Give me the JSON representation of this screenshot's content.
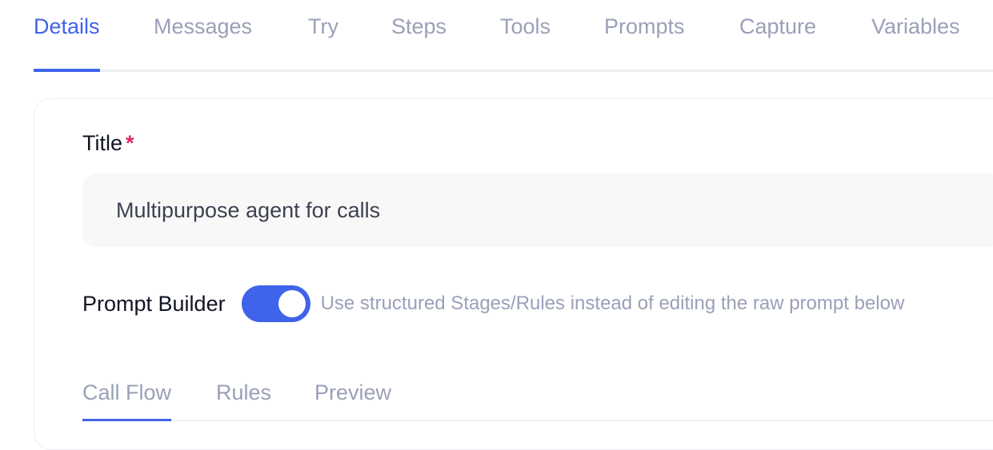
{
  "tabs": [
    {
      "label": "Details",
      "active": true
    },
    {
      "label": "Messages",
      "active": false
    },
    {
      "label": "Try",
      "active": false
    },
    {
      "label": "Steps",
      "active": false
    },
    {
      "label": "Tools",
      "active": false
    },
    {
      "label": "Prompts",
      "active": false
    },
    {
      "label": "Capture",
      "active": false
    },
    {
      "label": "Variables",
      "active": false
    }
  ],
  "form": {
    "title_label": "Title",
    "required_mark": "*",
    "title_value": "Multipurpose agent for calls",
    "prompt_builder_label": "Prompt Builder",
    "prompt_builder_enabled": true,
    "prompt_builder_hint": "Use structured Stages/Rules instead of editing the raw prompt below"
  },
  "sub_tabs": [
    {
      "label": "Call Flow",
      "active": true
    },
    {
      "label": "Rules",
      "active": false
    },
    {
      "label": "Preview",
      "active": false
    }
  ],
  "colors": {
    "accent": "#3f63ea",
    "required": "#e0245e",
    "muted_text": "#9aa0b8"
  }
}
